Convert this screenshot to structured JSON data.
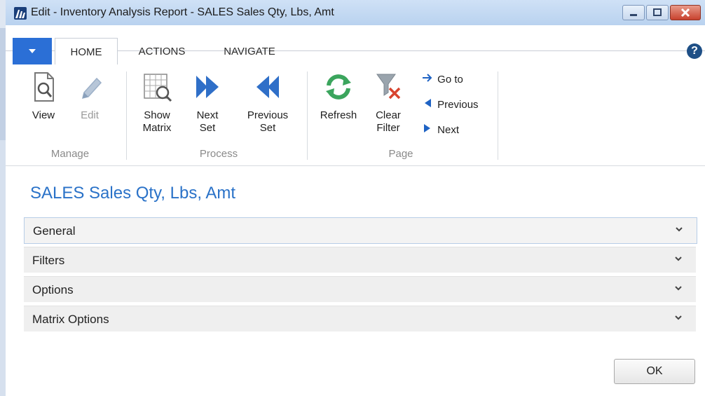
{
  "window": {
    "title": "Edit - Inventory Analysis Report - SALES Sales Qty, Lbs, Amt"
  },
  "ribbon_tabs": {
    "items": [
      {
        "label": "HOME"
      },
      {
        "label": "ACTIONS"
      },
      {
        "label": "NAVIGATE"
      }
    ],
    "help_label": "?"
  },
  "groups": {
    "manage": {
      "label": "Manage",
      "view_label": "View",
      "edit_label": "Edit"
    },
    "process": {
      "label": "Process",
      "show_matrix_line1": "Show",
      "show_matrix_line2": "Matrix",
      "next_set_line1": "Next",
      "next_set_line2": "Set",
      "previous_set_line1": "Previous",
      "previous_set_line2": "Set"
    },
    "page": {
      "label": "Page",
      "refresh_label": "Refresh",
      "clear_filter_line1": "Clear",
      "clear_filter_line2": "Filter",
      "goto_label": "Go to",
      "previous_label": "Previous",
      "next_label": "Next"
    }
  },
  "page": {
    "title": "SALES Sales Qty, Lbs, Amt"
  },
  "fasttabs": [
    {
      "label": "General"
    },
    {
      "label": "Filters"
    },
    {
      "label": "Options"
    },
    {
      "label": "Matrix Options"
    }
  ],
  "footer": {
    "ok_label": "OK"
  },
  "icons": {
    "app_icon": "dynamics-nav-icon",
    "view": "view-document-icon",
    "edit": "pencil-icon",
    "show_matrix": "matrix-magnifier-icon",
    "next_set": "double-arrow-right-icon",
    "previous_set": "double-arrow-left-icon",
    "refresh": "refresh-icon",
    "clear_filter": "clear-filter-icon",
    "goto": "arrow-right-icon",
    "previous": "triangle-left-icon",
    "next": "triangle-right-icon",
    "chevron": "chevron-down-icon"
  },
  "colors": {
    "accent_blue": "#2a72c8",
    "app_menu_blue": "#2b6fd6",
    "refresh_green": "#3ba55d",
    "clear_red": "#d8442f"
  }
}
